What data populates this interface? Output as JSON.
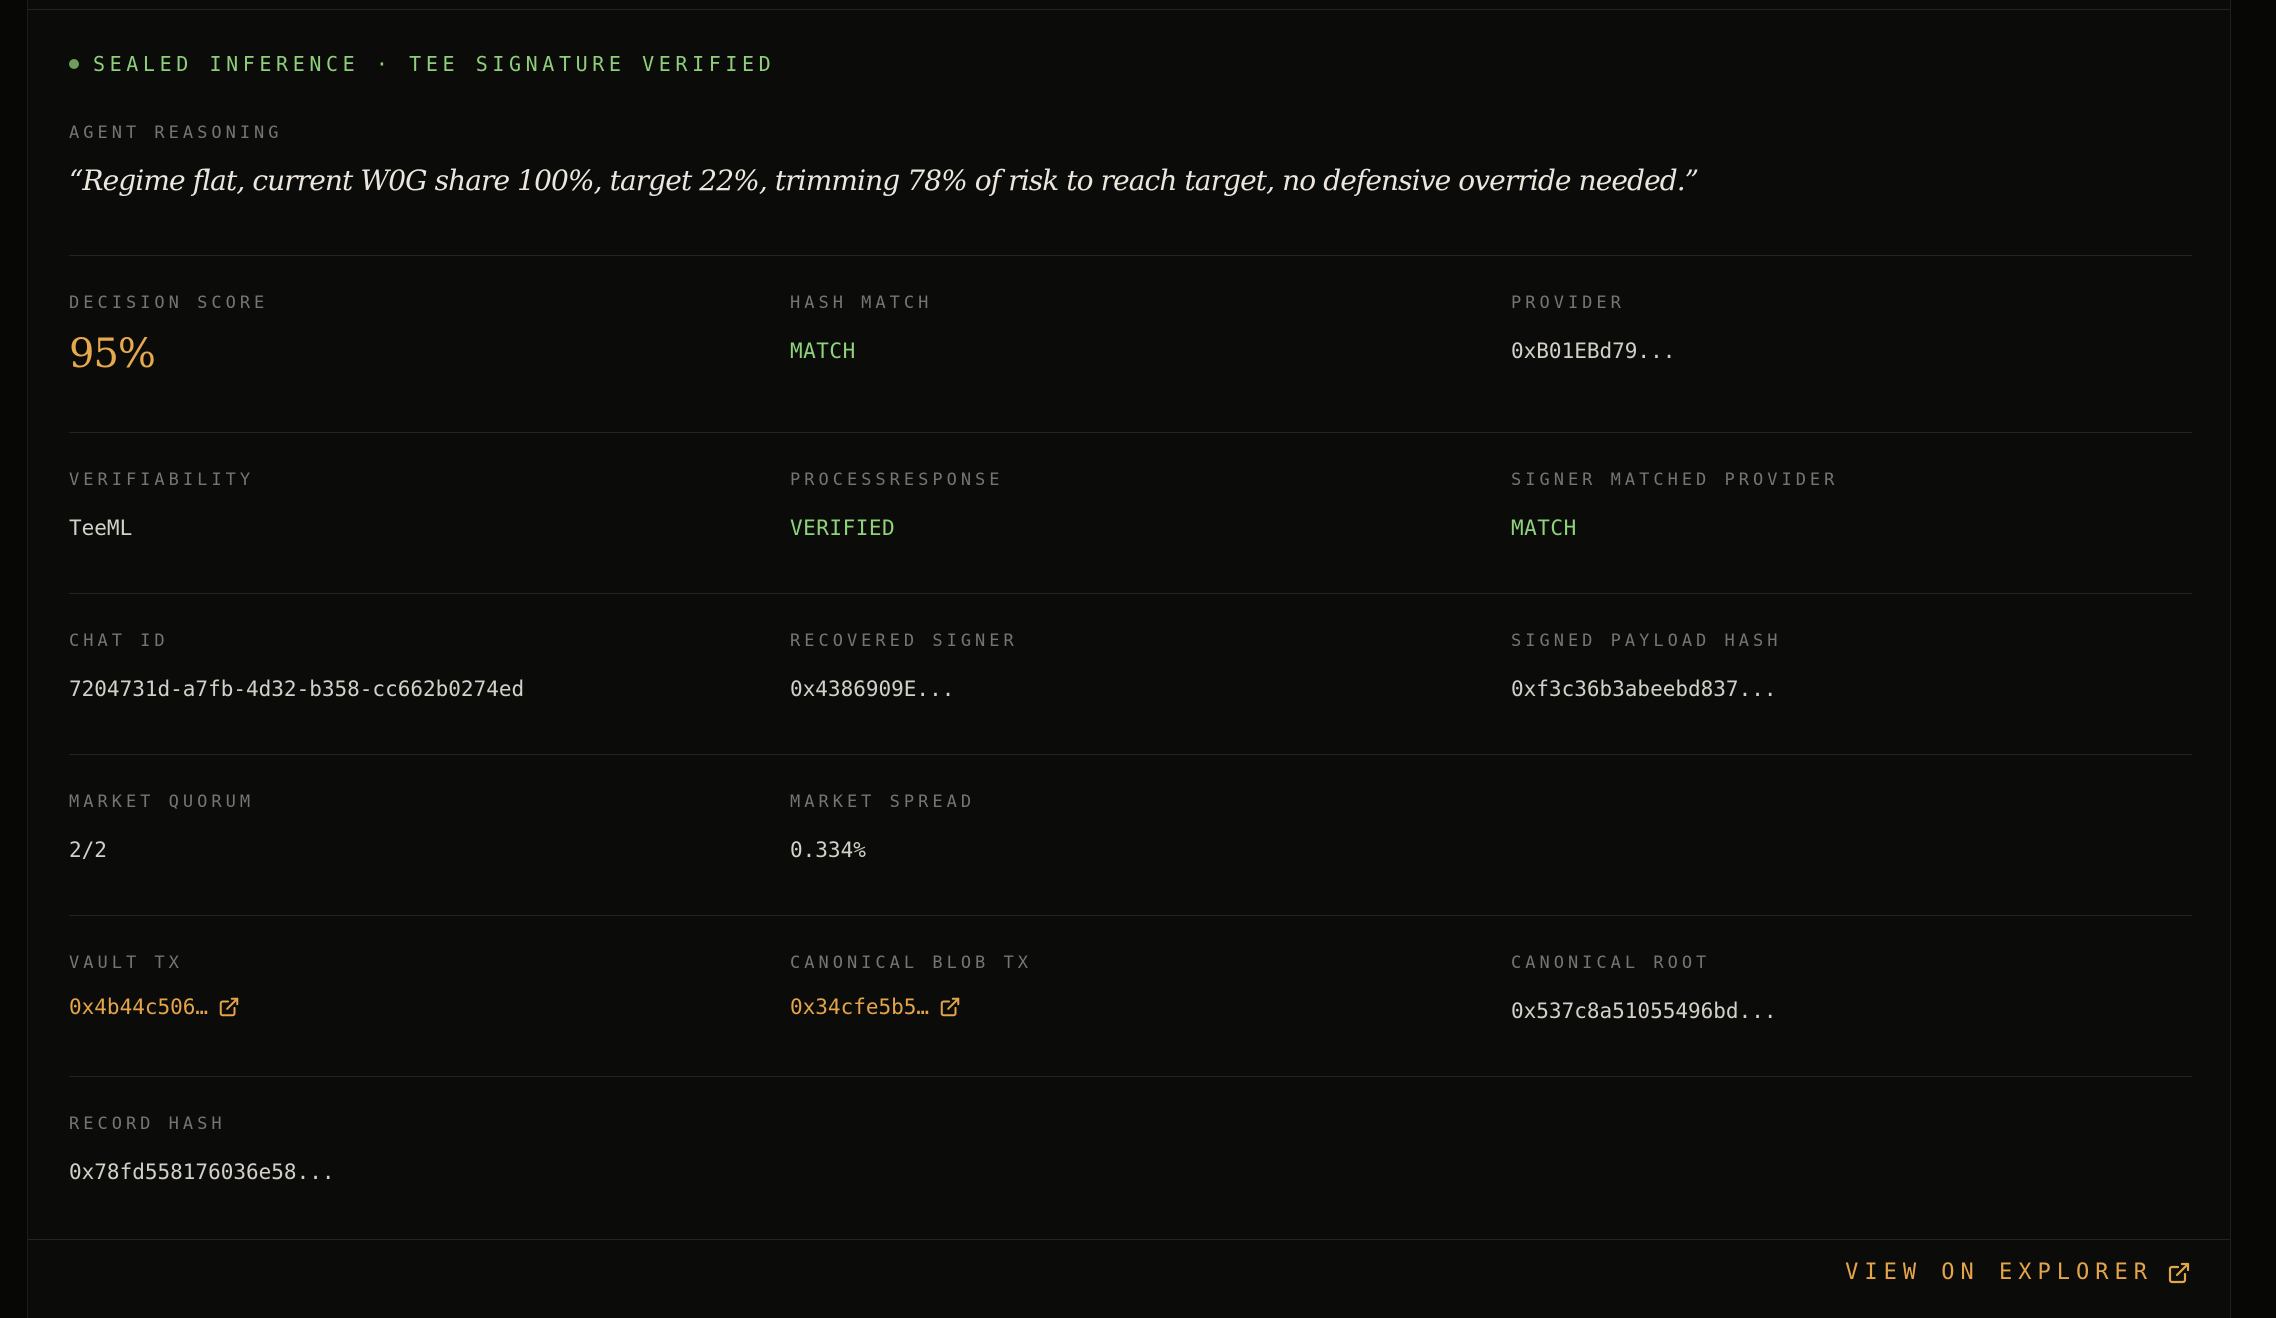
{
  "status": {
    "text": "SEALED INFERENCE · TEE SIGNATURE VERIFIED"
  },
  "reasoning": {
    "label": "AGENT REASONING",
    "quote": "“Regime flat, current W0G share 100%, target 22%, trimming 78% of risk to reach target, no defensive override needed.”"
  },
  "fields": {
    "decision_score": {
      "label": "DECISION SCORE",
      "value": "95%"
    },
    "hash_match": {
      "label": "HASH MATCH",
      "value": "MATCH"
    },
    "provider": {
      "label": "PROVIDER",
      "value": "0xB01EBd79..."
    },
    "verifiability": {
      "label": "VERIFIABILITY",
      "value": "TeeML"
    },
    "process_response": {
      "label": "PROCESSRESPONSE",
      "value": "VERIFIED"
    },
    "signer_matched": {
      "label": "SIGNER MATCHED PROVIDER",
      "value": "MATCH"
    },
    "chat_id": {
      "label": "CHAT ID",
      "value": "7204731d-a7fb-4d32-b358-cc662b0274ed"
    },
    "recovered_signer": {
      "label": "RECOVERED SIGNER",
      "value": "0x4386909E..."
    },
    "signed_payload_hash": {
      "label": "SIGNED PAYLOAD HASH",
      "value": "0xf3c36b3abeebd837..."
    },
    "market_quorum": {
      "label": "MARKET QUORUM",
      "value": "2/2"
    },
    "market_spread": {
      "label": "MARKET SPREAD",
      "value": "0.334%"
    },
    "vault_tx": {
      "label": "VAULT TX",
      "value": "0x4b44c506…"
    },
    "canonical_blob_tx": {
      "label": "CANONICAL BLOB TX",
      "value": "0x34cfe5b5…"
    },
    "canonical_root": {
      "label": "CANONICAL ROOT",
      "value": "0x537c8a51055496bd..."
    },
    "record_hash": {
      "label": "RECORD HASH",
      "value": "0x78fd558176036e58..."
    }
  },
  "footer": {
    "explorer_label": "VIEW ON EXPLORER"
  },
  "icons": {
    "status": "status-dot-icon",
    "external": "external-link-icon"
  },
  "colors": {
    "accent": "#e4a44a",
    "success": "#8fd27c",
    "background": "#0b0b0a"
  }
}
